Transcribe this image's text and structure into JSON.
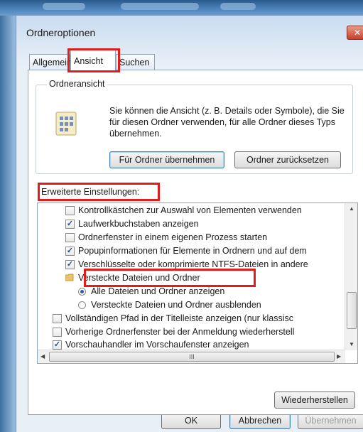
{
  "dialog": {
    "title": "Ordneroptionen",
    "close_label": "✕"
  },
  "tabs": [
    {
      "label": "Allgemein"
    },
    {
      "label": "Ansicht"
    },
    {
      "label": "Suchen"
    }
  ],
  "folder_view": {
    "group_label": "Ordneransicht",
    "description": "Sie können die Ansicht (z. B. Details oder Symbole), die Sie für diesen Ordner verwenden, für alle Ordner dieses Typs übernehmen.",
    "apply_label": "Für Ordner übernehmen",
    "reset_label": "Ordner zurücksetzen"
  },
  "advanced": {
    "label": "Erweiterte Einstellungen:",
    "items": [
      {
        "type": "checkbox",
        "checked": false,
        "label": "Kontrollkästchen zur Auswahl von Elementen verwenden"
      },
      {
        "type": "checkbox",
        "checked": true,
        "label": "Laufwerkbuchstaben anzeigen"
      },
      {
        "type": "checkbox",
        "checked": false,
        "label": "Ordnerfenster in einem eigenen Prozess starten"
      },
      {
        "type": "checkbox",
        "checked": true,
        "label": "Popupinformationen für Elemente in Ordnern und auf dem"
      },
      {
        "type": "checkbox",
        "checked": true,
        "label": "Verschlüsselte oder komprimierte NTFS-Dateien in andere"
      },
      {
        "type": "folder",
        "label": "Versteckte Dateien und Ordner"
      },
      {
        "type": "radio",
        "checked": true,
        "label": "Alle Dateien und Ordner anzeigen"
      },
      {
        "type": "radio",
        "checked": false,
        "label": "Versteckte Dateien und Ordner ausblenden"
      },
      {
        "type": "checkbox",
        "checked": false,
        "label": "Vollständigen Pfad in der Titelleiste anzeigen (nur klassisc"
      },
      {
        "type": "checkbox",
        "checked": false,
        "label": "Vorherige Ordnerfenster bei der Anmeldung wiederherstell"
      },
      {
        "type": "checkbox",
        "checked": true,
        "label": "Vorschauhandler im Vorschaufenster anzeigen"
      }
    ],
    "hscroll_grip": "III",
    "restore_label": "Wiederherstellen"
  },
  "footer": {
    "ok_label": "OK",
    "cancel_label": "Abbrechen",
    "apply_label": "Übernehmen"
  },
  "colors": {
    "highlight": "#e21b1b",
    "accent": "#2c5da8"
  }
}
